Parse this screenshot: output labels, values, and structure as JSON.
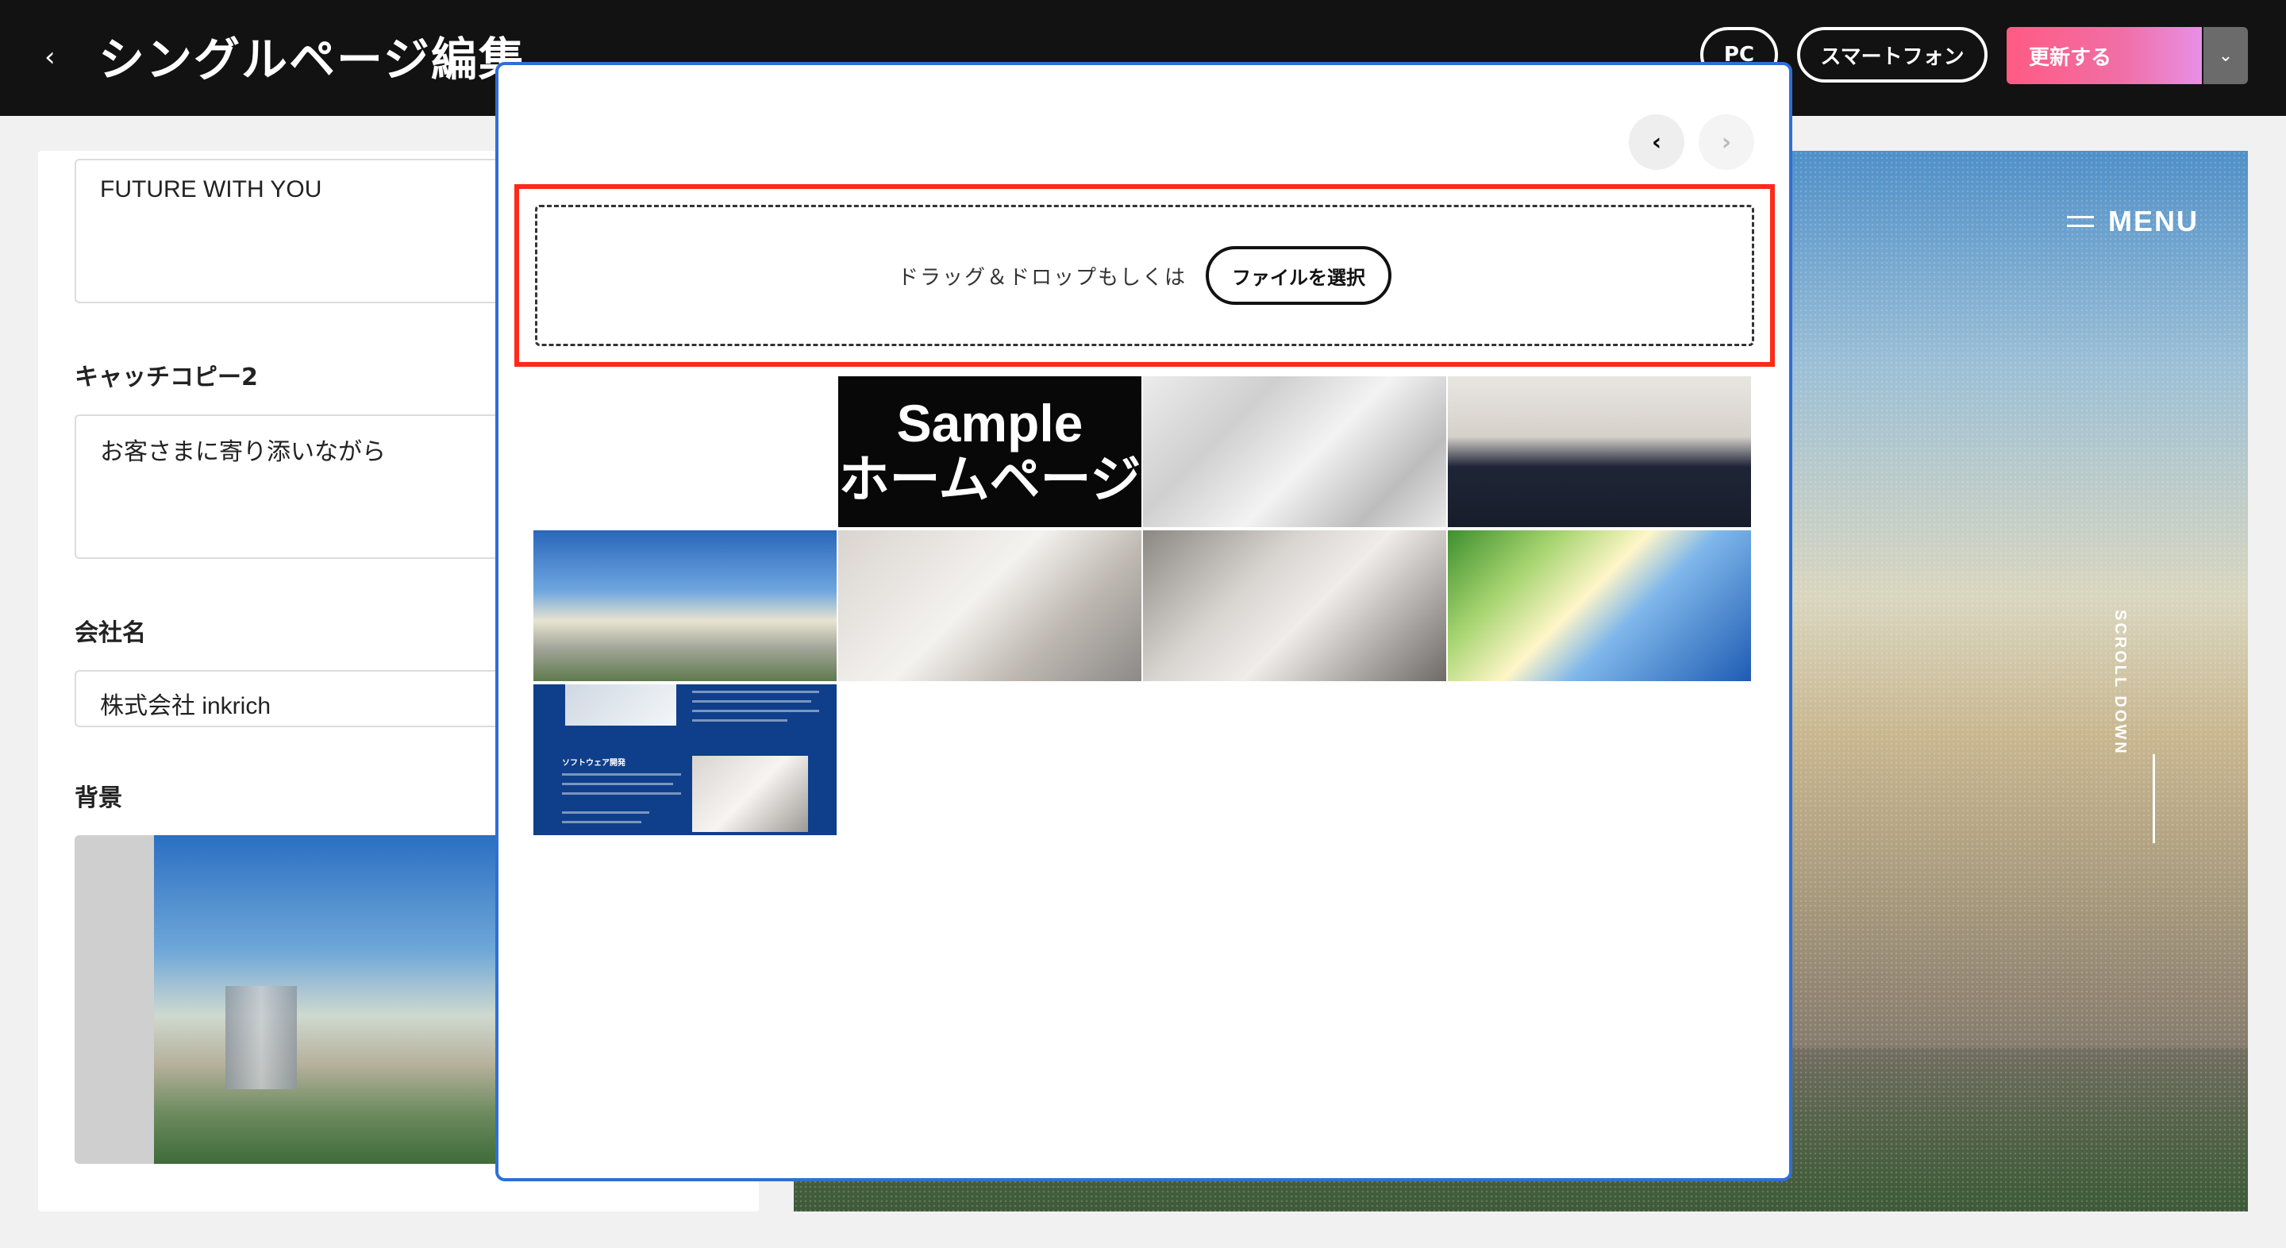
{
  "header": {
    "back_glyph": "‹",
    "title": "シングルページ編集",
    "pc_label": "PC",
    "smartphone_label": "スマートフォン",
    "update_label": "更新する",
    "caret_glyph": "⌄"
  },
  "form": {
    "catch1_value": "FUTURE WITH YOU",
    "catch2_label": "キャッチコピー2",
    "catch2_value": "お客さまに寄り添いながら",
    "company_label": "会社名",
    "company_value": "株式会社 inkrich",
    "background_label": "背景"
  },
  "preview": {
    "menu_label": "MENU",
    "scroll_label": "SCROLL DOWN"
  },
  "modal": {
    "prev_glyph": "‹",
    "next_glyph": "›",
    "drop_text": "ドラッグ＆ドロップもしくは",
    "file_button": "ファイルを選択",
    "sample_line1": "Sample",
    "sample_line2": "ホームページ",
    "brochure_heading": "ソフトウェア開発"
  },
  "colors": {
    "header_bg": "#121212",
    "modal_border": "#2f6fd6",
    "highlight": "#ff2a1a",
    "update_gradient_start": "#ff5a84",
    "update_gradient_end": "#e890e6"
  }
}
